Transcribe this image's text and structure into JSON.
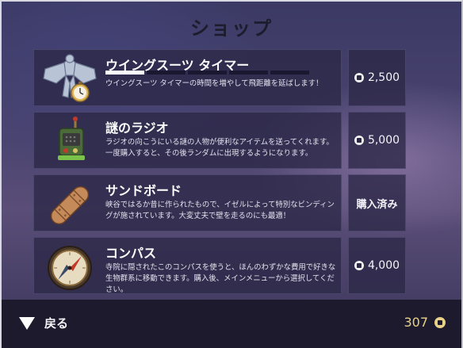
{
  "screen_title": "ショップ",
  "items": [
    {
      "name": "ウイングスーツ タイマー",
      "description": "ウイングスーツ タイマーの時間を増やして飛距離を延ばします！",
      "price": "2,500",
      "upgrade_level": 1,
      "upgrade_max": 5,
      "icon": "wingsuit-timer-icon"
    },
    {
      "name": "謎のラジオ",
      "description": "ラジオの向こうにいる謎の人物が便利なアイテムを送ってくれます。一度購入すると、その後ランダムに出現するようになります。",
      "price": "5,000",
      "icon": "radio-icon"
    },
    {
      "name": "サンドボード",
      "description": "峡谷ではるか昔に作られたもので、イゼルによって特別なビンディングが施されています。大変丈夫で壁を走るのにも最適！",
      "status": "購入済み",
      "icon": "sandboard-icon"
    },
    {
      "name": "コンパス",
      "description": "寺院に隠されたこのコンパスを使うと、ほんのわずかな費用で好きな生物群系に移動できます。購入後、メインメニューから選択してください。",
      "price": "4,000",
      "icon": "compass-icon"
    }
  ],
  "footer": {
    "back_label": "戻る",
    "balance": "307"
  },
  "colors": {
    "balance": "#e8d28a",
    "card_bg": "#2c2846",
    "footer_bg": "#1c1a2c"
  }
}
